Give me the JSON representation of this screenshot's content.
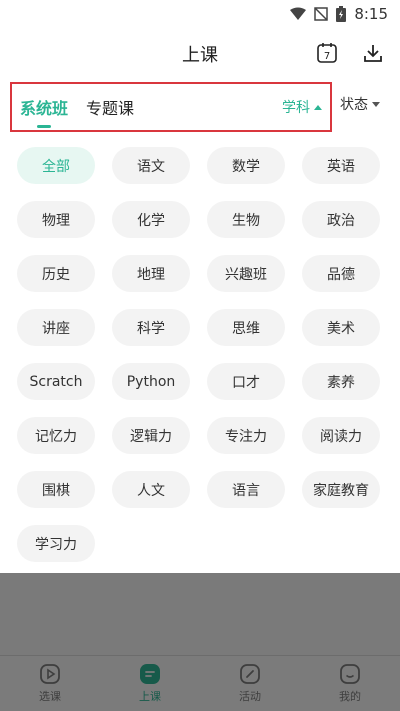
{
  "status_bar": {
    "time": "8:15",
    "icons": [
      "wifi-icon",
      "no-signal-icon",
      "battery-charging-icon"
    ]
  },
  "header": {
    "title": "上课",
    "calendar_day": "7",
    "actions": [
      "calendar-icon",
      "download-icon"
    ]
  },
  "tabs": [
    {
      "label": "系统班",
      "active": true
    },
    {
      "label": "专题课",
      "active": false
    }
  ],
  "filters": {
    "subject": "学科",
    "status": "状态"
  },
  "subjects": [
    "全部",
    "语文",
    "数学",
    "英语",
    "物理",
    "化学",
    "生物",
    "政治",
    "历史",
    "地理",
    "兴趣班",
    "品德",
    "讲座",
    "科学",
    "思维",
    "美术",
    "Scratch",
    "Python",
    "口才",
    "素养",
    "记忆力",
    "逻辑力",
    "专注力",
    "阅读力",
    "围棋",
    "人文",
    "语言",
    "家庭教育",
    "学习力"
  ],
  "selected_subject_index": 0,
  "bottom_nav": [
    {
      "label": "选课",
      "icon": "play-circle-icon",
      "active": false
    },
    {
      "label": "上课",
      "icon": "class-icon",
      "active": true
    },
    {
      "label": "活动",
      "icon": "edit-icon",
      "active": false
    },
    {
      "label": "我的",
      "icon": "smiley-icon",
      "active": false
    }
  ],
  "colors": {
    "accent": "#2bb594",
    "highlight_border": "#d9363e",
    "chip_bg": "#f3f3f3",
    "overlay": "#7a7a7a"
  }
}
